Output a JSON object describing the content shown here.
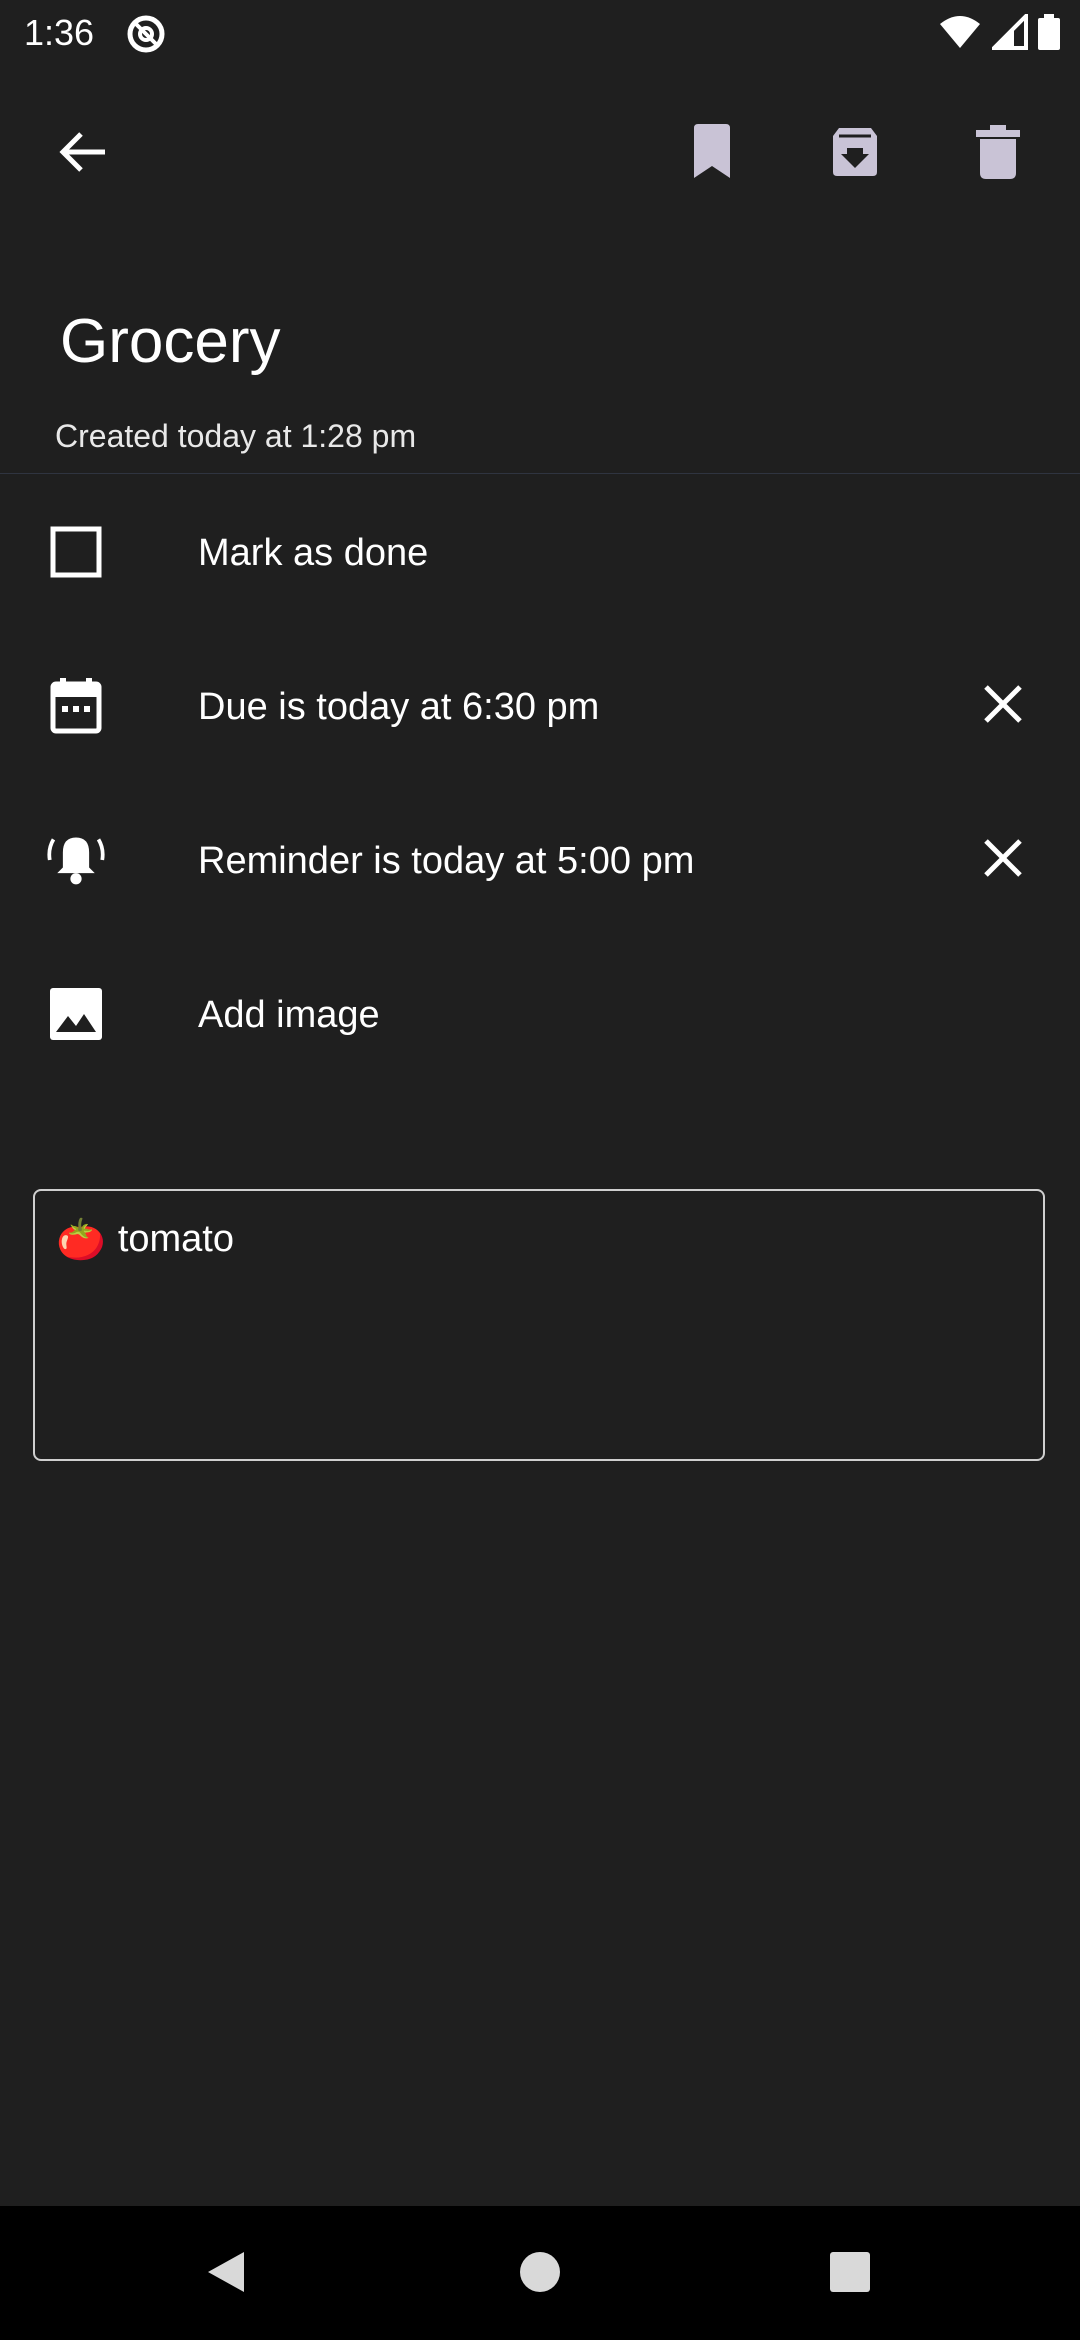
{
  "status_bar": {
    "time": "1:36",
    "icons": [
      "at-sign-icon",
      "wifi-icon",
      "signal-icon",
      "battery-icon"
    ]
  },
  "toolbar": {
    "back_icon": "arrow-left-icon",
    "actions": [
      "bookmark-icon",
      "archive-icon",
      "delete-icon"
    ]
  },
  "note": {
    "title": "Grocery",
    "created": "Created today at 1:28 pm"
  },
  "options": {
    "mark_done": "Mark as done",
    "due": "Due is today at 6:30 pm",
    "reminder": "Reminder is today at 5:00 pm",
    "add_image": "Add image"
  },
  "content": {
    "emoji": "🍅",
    "text": "tomato"
  },
  "nav": {
    "icons": [
      "back-triangle-icon",
      "home-circle-icon",
      "recents-square-icon"
    ]
  },
  "colors": {
    "background": "#1f1f1f",
    "text": "#ffffff",
    "nav_bar": "#000000"
  }
}
